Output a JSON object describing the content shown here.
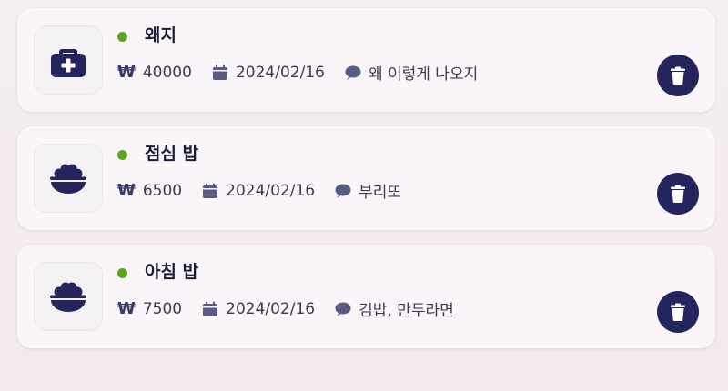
{
  "accent_colors": {
    "dot": "#5aa81a",
    "icon": "#25255e",
    "delete_button": "#25255e"
  },
  "currency_symbol": "₩",
  "items": [
    {
      "icon": "medical-kit-icon",
      "title": "왜지",
      "amount": "40000",
      "date": "2024/02/16",
      "memo": "왜 이렇게 나오지"
    },
    {
      "icon": "rice-bowl-icon",
      "title": "점심 밥",
      "amount": "6500",
      "date": "2024/02/16",
      "memo": "부리또"
    },
    {
      "icon": "rice-bowl-icon",
      "title": "아침 밥",
      "amount": "7500",
      "date": "2024/02/16",
      "memo": "김밥, 만두라면"
    }
  ]
}
